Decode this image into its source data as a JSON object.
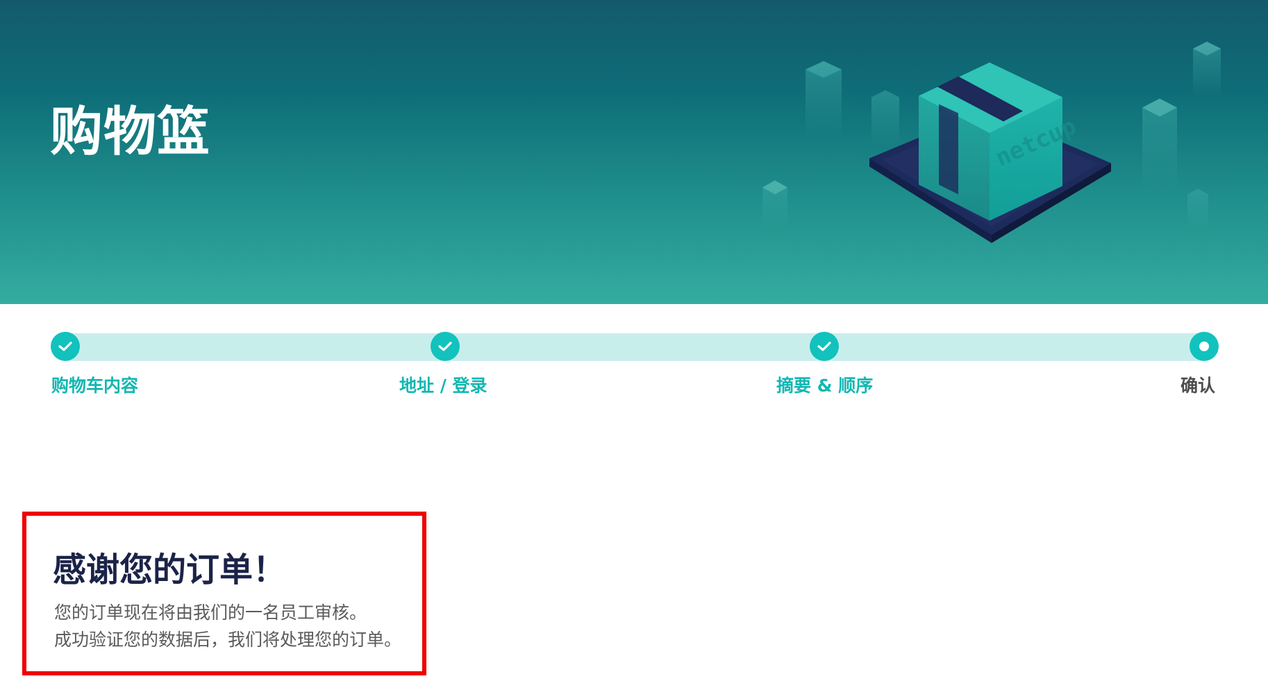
{
  "header": {
    "title": "购物篮",
    "illustration_brand": "netcup"
  },
  "stepper": {
    "steps": [
      {
        "label": "购物车内容",
        "status": "done"
      },
      {
        "label": "地址 / 登录",
        "status": "done"
      },
      {
        "label": "摘要 & 顺序",
        "status": "done"
      },
      {
        "label": "确认",
        "status": "current"
      }
    ]
  },
  "confirmation": {
    "title": "感谢您的订单！",
    "line1": "您的订单现在将由我们的一名员工审核。",
    "line2": "成功验证您的数据后，我们将处理您的订单。"
  },
  "colors": {
    "accent": "#12c2bd",
    "track": "#c8eeec",
    "heading": "#1b2348",
    "highlight_border": "#ee0000"
  }
}
